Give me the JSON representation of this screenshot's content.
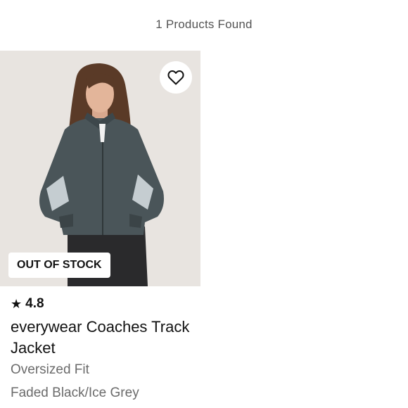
{
  "results": {
    "count_text": "1 Products Found"
  },
  "product": {
    "badge": "OUT OF STOCK",
    "rating": "4.8",
    "name": "everywear Coaches Track Jacket",
    "fit": "Oversized Fit",
    "color": "Faded Black/Ice Grey",
    "icons": {
      "wishlist": "heart-outline-icon",
      "rating": "star-icon"
    }
  }
}
